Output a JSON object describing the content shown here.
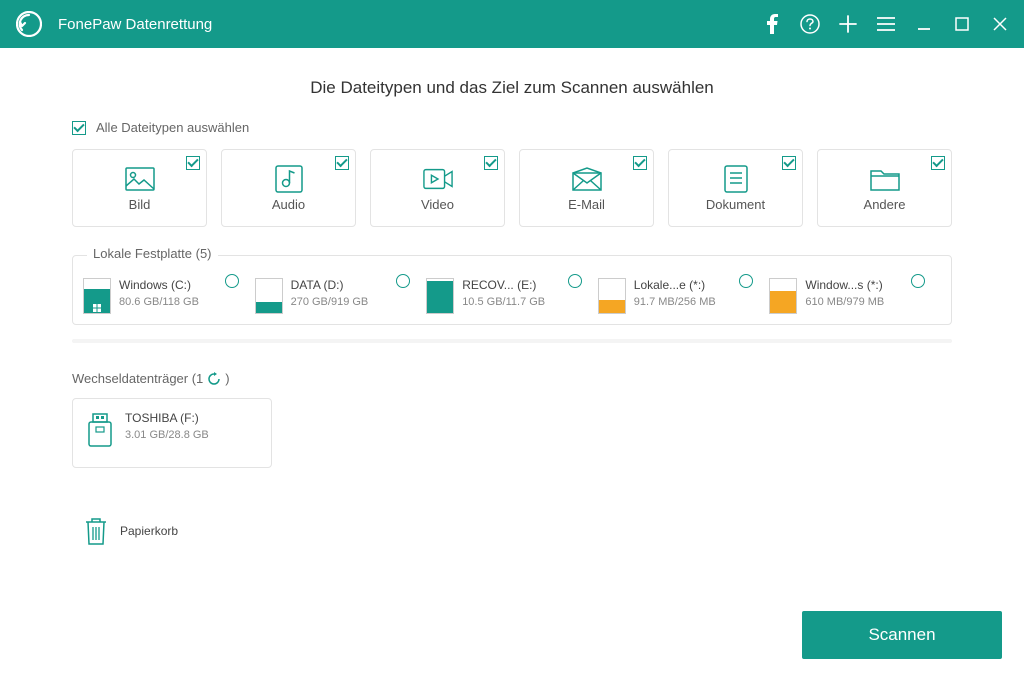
{
  "app": {
    "title": "FonePaw Datenrettung"
  },
  "heading": "Die Dateitypen und das Ziel zum Scannen auswählen",
  "typeSection": {
    "selectAll": "Alle Dateitypen auswählen",
    "types": {
      "image": "Bild",
      "audio": "Audio",
      "video": "Video",
      "email": "E-Mail",
      "document": "Dokument",
      "other": "Andere"
    }
  },
  "localDisks": {
    "legend": "Lokale Festplatte (5)",
    "items": [
      {
        "name": "Windows (C:)",
        "size": "80.6 GB/118 GB",
        "fillPct": 68,
        "color": "teal",
        "system": true
      },
      {
        "name": "DATA (D:)",
        "size": "270 GB/919 GB",
        "fillPct": 30,
        "color": "teal",
        "system": false
      },
      {
        "name": "RECOV... (E:)",
        "size": "10.5 GB/11.7 GB",
        "fillPct": 90,
        "color": "teal",
        "system": false
      },
      {
        "name": "Lokale...e (*:)",
        "size": "91.7 MB/256 MB",
        "fillPct": 36,
        "color": "orange",
        "system": false
      },
      {
        "name": "Window...s (*:)",
        "size": "610 MB/979 MB",
        "fillPct": 62,
        "color": "orange",
        "system": false
      }
    ]
  },
  "removable": {
    "legend": "Wechseldatenträger (1",
    "item": {
      "name": "TOSHIBA (F:)",
      "size": "3.01 GB/28.8 GB"
    }
  },
  "recycle": {
    "label": "Papierkorb"
  },
  "scanButton": "Scannen"
}
